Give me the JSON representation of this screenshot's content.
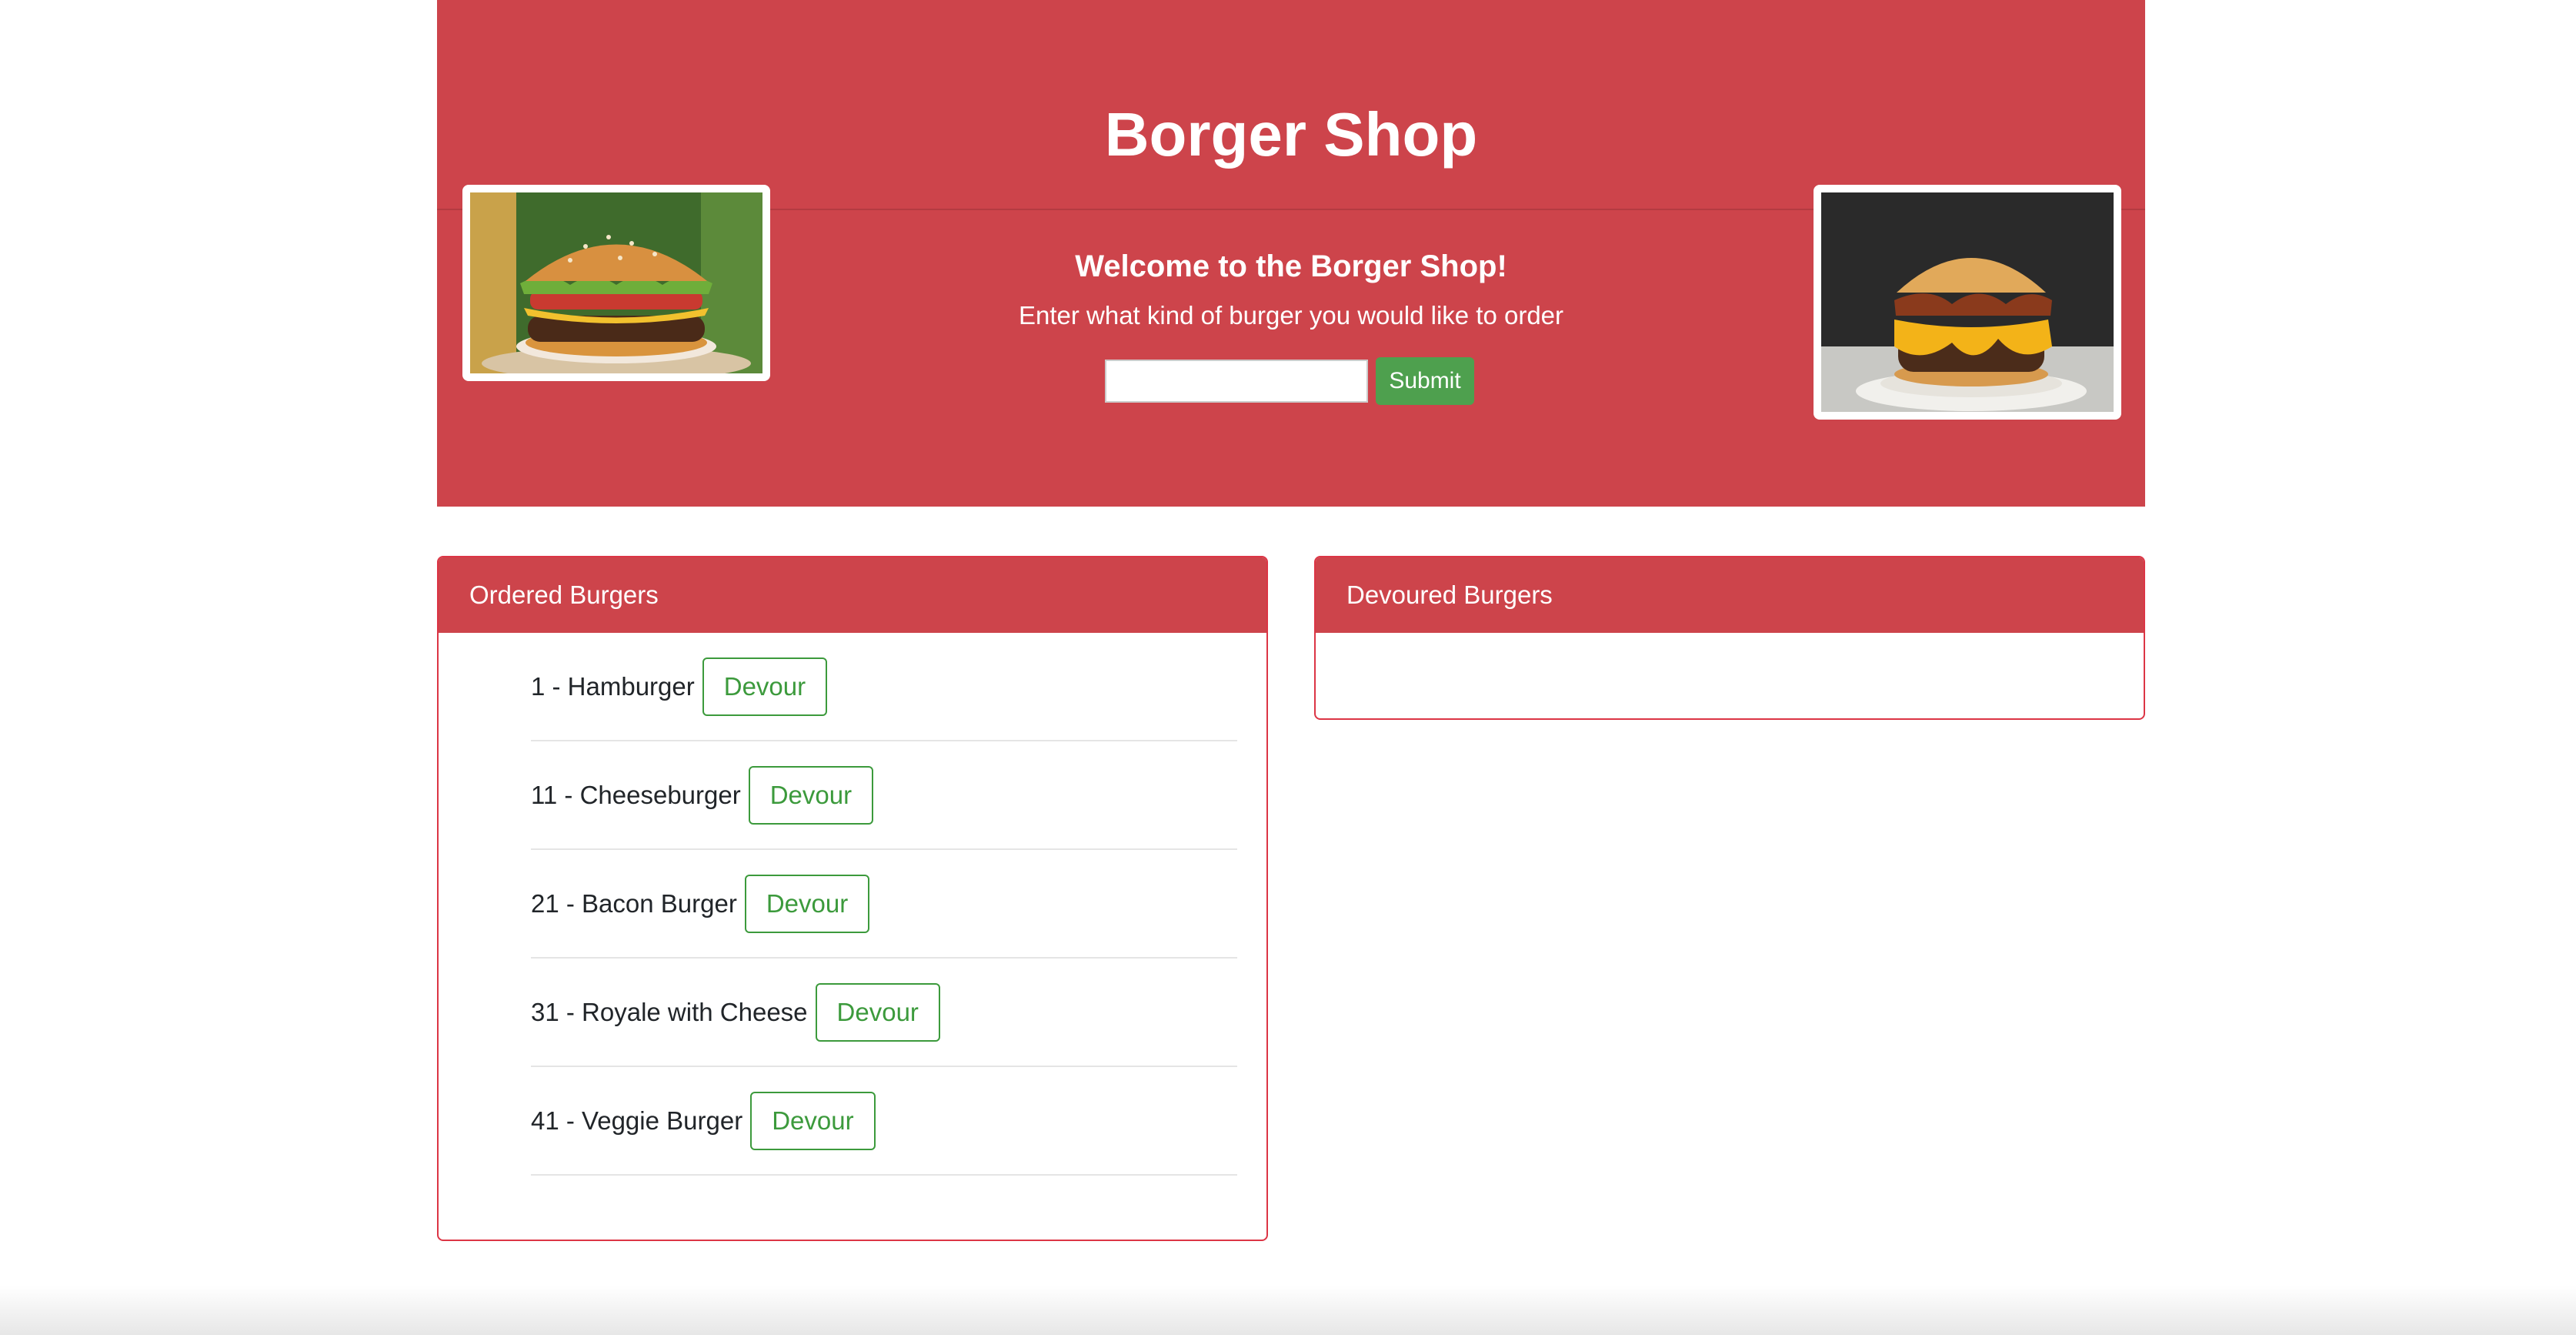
{
  "header": {
    "title": "Borger Shop",
    "welcome": "Welcome to the Borger Shop!",
    "prompt": "Enter what kind of burger you would like to order"
  },
  "order_form": {
    "input_value": "",
    "input_placeholder": "",
    "submit_label": "Submit"
  },
  "ordered": {
    "heading": "Ordered Burgers",
    "devour_label": "Devour",
    "items": [
      {
        "label": "1 - Hamburger"
      },
      {
        "label": "11 - Cheeseburger"
      },
      {
        "label": "21 - Bacon Burger"
      },
      {
        "label": "31 - Royale with Cheese"
      },
      {
        "label": "41 - Veggie Burger"
      }
    ]
  },
  "devoured": {
    "heading": "Devoured Burgers",
    "items": []
  },
  "colors": {
    "brand_red": "#cd444b",
    "card_border": "#dc3545",
    "submit_green": "#4ea04e",
    "devour_green": "#3c9a3c"
  }
}
